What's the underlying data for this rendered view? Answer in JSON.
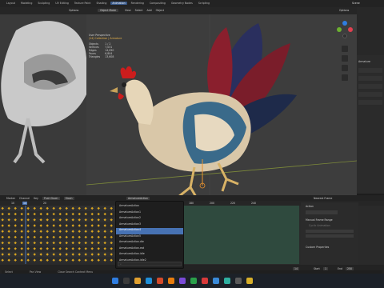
{
  "app": {
    "workspace_tabs": [
      "Layout",
      "Modeling",
      "Sculpting",
      "UV Editing",
      "Texture Paint",
      "Shading",
      "Animation",
      "Rendering",
      "Compositing",
      "Geometry Nodes",
      "Scripting"
    ],
    "active_tab": "Animation",
    "scene": "Scene"
  },
  "viewport": {
    "mode": "Object Mode",
    "menus": [
      "View",
      "Select",
      "Add",
      "Object"
    ],
    "options": "Options",
    "perspective": "User Perspective",
    "collection": "(14) Collection | Armature",
    "stats": [
      {
        "label": "Objects",
        "value": "1 / 2"
      },
      {
        "label": "Vertices",
        "value": "7,031"
      },
      {
        "label": "Edges",
        "value": "14,090"
      },
      {
        "label": "Faces",
        "value": "6,804"
      },
      {
        "label": "Triangles",
        "value": "13,608"
      }
    ]
  },
  "left_view": {
    "options": "Options"
  },
  "properties": {
    "armature": "Armature",
    "sections": [
      "Action",
      "Manual Frame Range",
      "Cyclic Animation",
      "Custom Properties"
    ]
  },
  "timeline": {
    "menus": [
      "Marker",
      "Channel",
      "Key"
    ],
    "push_down": "Push Down",
    "stash": "Stash",
    "action_name": "ArmatureAction",
    "frame_marks": [
      "10",
      "20"
    ],
    "ruler": [
      "180",
      "200",
      "220",
      "240"
    ],
    "nearest_frame": "Nearest Frame",
    "start_label": "Start",
    "start": "1",
    "end_label": "End",
    "end": "250",
    "current_frame": "14"
  },
  "action_list": [
    "ArmatureAction",
    "ArmatureAction1",
    "ArmatureAction2",
    "ArmatureAction3",
    "ArmatureAction4",
    "ArmatureAction5",
    "ArmatureAction.die",
    "ArmatureAction.eat",
    "ArmatureAction.idle",
    "ArmatureAction.idle2",
    "ArmatureAction.idle3",
    "ArmatureAction.walk"
  ],
  "selected_action_index": 4,
  "status": {
    "select": "Select",
    "pan_view": "Pan View",
    "context": "Close Search Context Menu"
  },
  "colors": {
    "accent": "#4772b3",
    "active_tab": "#3a5a8a",
    "key_yellow": "#d9a521"
  }
}
